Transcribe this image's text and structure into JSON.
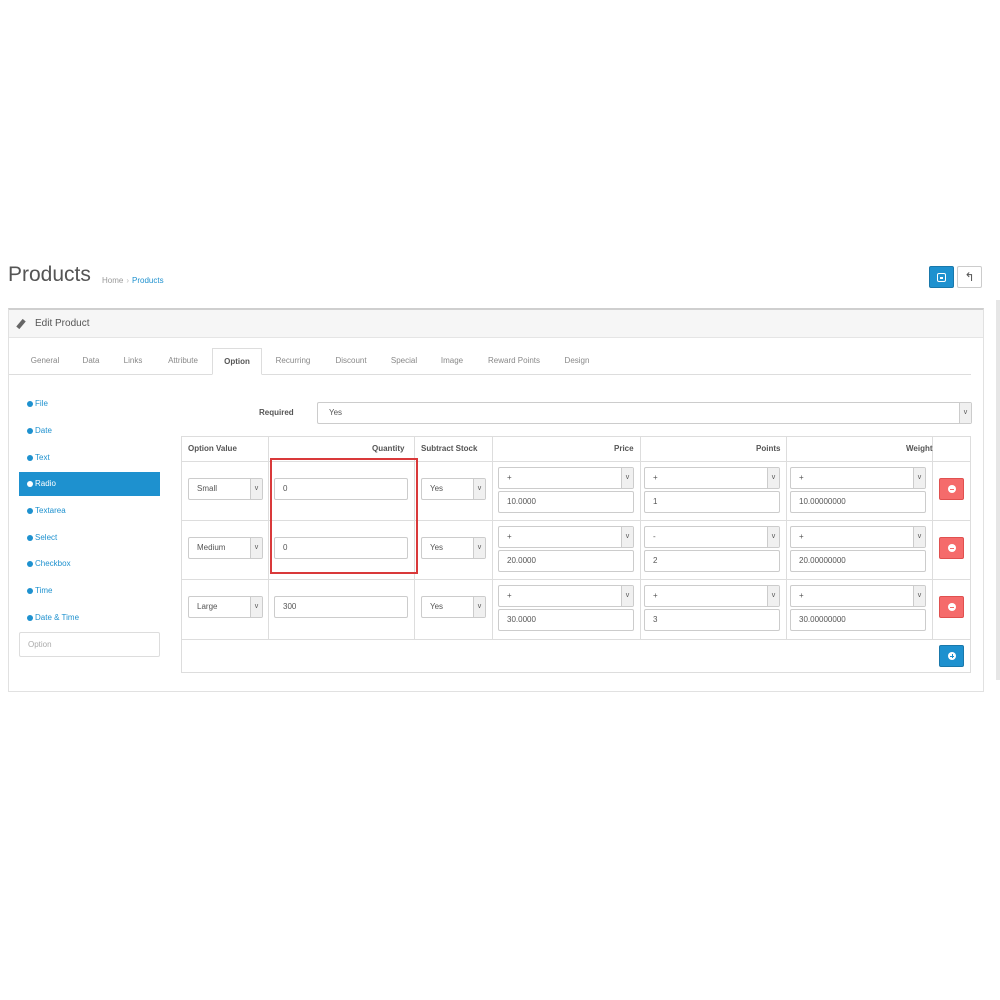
{
  "page": {
    "title": "Products",
    "breadcrumb": [
      "Home",
      "Products"
    ],
    "save_icon": "save-icon",
    "back_icon": "reply-icon"
  },
  "panel": {
    "title": "Edit Product",
    "icon": "pencil-icon"
  },
  "tabs": [
    {
      "label": "General"
    },
    {
      "label": "Data"
    },
    {
      "label": "Links"
    },
    {
      "label": "Attribute"
    },
    {
      "label": "Option",
      "active": true
    },
    {
      "label": "Recurring"
    },
    {
      "label": "Discount"
    },
    {
      "label": "Special"
    },
    {
      "label": "Image"
    },
    {
      "label": "Reward Points"
    },
    {
      "label": "Design"
    }
  ],
  "sidebar": {
    "items": [
      {
        "label": "File"
      },
      {
        "label": "Date"
      },
      {
        "label": "Text"
      },
      {
        "label": "Radio",
        "active": true
      },
      {
        "label": "Textarea"
      },
      {
        "label": "Select"
      },
      {
        "label": "Checkbox"
      },
      {
        "label": "Time"
      },
      {
        "label": "Date & Time"
      }
    ],
    "input_placeholder": "Option"
  },
  "required": {
    "label": "Required",
    "value": "Yes"
  },
  "table": {
    "headers": {
      "option_value": "Option Value",
      "quantity": "Quantity",
      "subtract": "Subtract Stock",
      "price": "Price",
      "points": "Points",
      "weight": "Weight"
    },
    "rows": [
      {
        "option": "Small",
        "quantity": "0",
        "subtract": "Yes",
        "price_prefix": "+",
        "price": "10.0000",
        "points_prefix": "+",
        "points": "1",
        "weight_prefix": "+",
        "weight": "10.00000000"
      },
      {
        "option": "Medium",
        "quantity": "0",
        "subtract": "Yes",
        "price_prefix": "+",
        "price": "20.0000",
        "points_prefix": "-",
        "points": "2",
        "weight_prefix": "+",
        "weight": "20.00000000"
      },
      {
        "option": "Large",
        "quantity": "300",
        "subtract": "Yes",
        "price_prefix": "+",
        "price": "30.0000",
        "points_prefix": "+",
        "points": "3",
        "weight_prefix": "+",
        "weight": "30.00000000"
      }
    ],
    "arrow_glyph": "v"
  },
  "colors": {
    "primary": "#1e91cf",
    "danger": "#f56b6b",
    "highlight": "#d9393a"
  }
}
